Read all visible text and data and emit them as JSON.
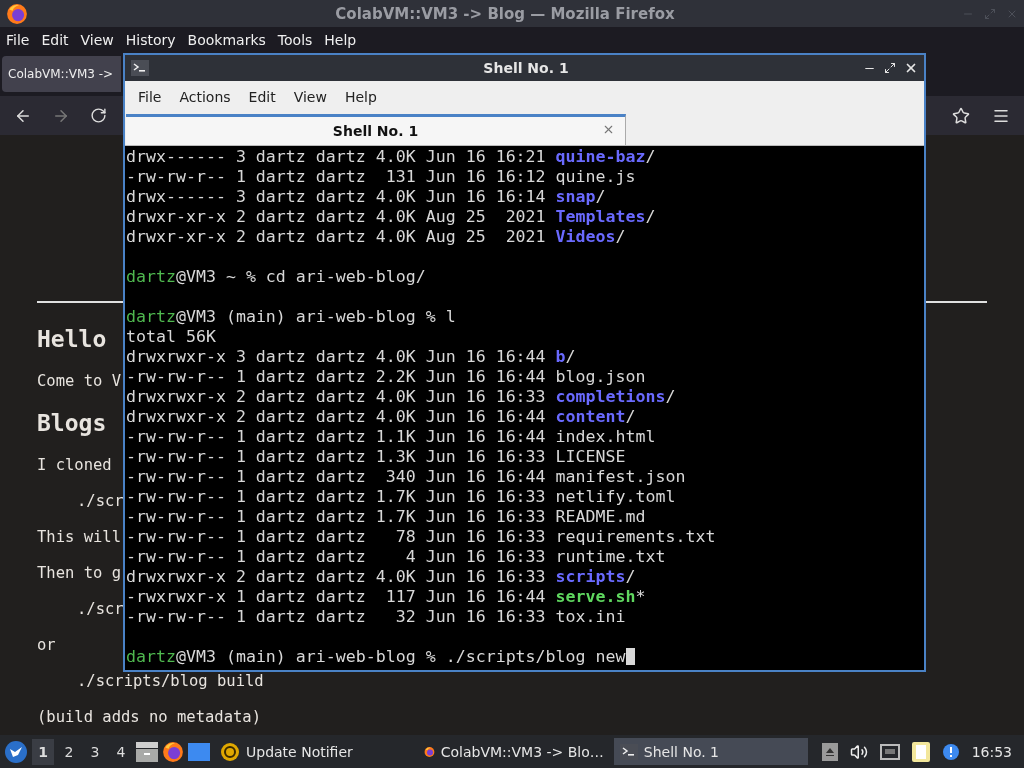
{
  "browser": {
    "title": "ColabVM::VM3 -> Blog — Mozilla Firefox",
    "menu": [
      "File",
      "Edit",
      "View",
      "History",
      "Bookmarks",
      "Tools",
      "Help"
    ],
    "tab": {
      "label": "ColabVM::VM3 ->"
    },
    "page": [
      {
        "kind": "heading",
        "text": "Hello"
      },
      {
        "kind": "para",
        "text": "Come to V"
      },
      {
        "kind": "heading",
        "text": "Blogs"
      },
      {
        "kind": "para",
        "text": "I cloned"
      },
      {
        "kind": "code",
        "text": "./scr"
      },
      {
        "kind": "para",
        "text": "This will"
      },
      {
        "kind": "para",
        "text": "Then to g"
      },
      {
        "kind": "code",
        "text": "./scr"
      },
      {
        "kind": "para",
        "text": "or"
      },
      {
        "kind": "code",
        "text": "./scripts/blog build"
      },
      {
        "kind": "para",
        "text": "(build adds no metadata)"
      }
    ]
  },
  "terminal": {
    "title": "Shell No. 1",
    "menu": [
      "File",
      "Actions",
      "Edit",
      "View",
      "Help"
    ],
    "tabs": [
      {
        "label": "Shell No. 1",
        "selected": true
      }
    ],
    "lines": [
      {
        "kind": "dir",
        "prefix": "drwx------ 3 dartz dartz 4.0K Jun 16 16:21 ",
        "name": "quine-baz",
        "suffix": "/"
      },
      {
        "kind": "file",
        "prefix": "-rw-rw-r-- 1 dartz dartz  131 Jun 16 16:12 ",
        "name": "quine.js"
      },
      {
        "kind": "dir",
        "prefix": "drwx------ 3 dartz dartz 4.0K Jun 16 16:14 ",
        "name": "snap",
        "suffix": "/"
      },
      {
        "kind": "dir",
        "prefix": "drwxr-xr-x 2 dartz dartz 4.0K Aug 25  2021 ",
        "name": "Templates",
        "suffix": "/"
      },
      {
        "kind": "dir",
        "prefix": "drwxr-xr-x 2 dartz dartz 4.0K Aug 25  2021 ",
        "name": "Videos",
        "suffix": "/"
      },
      {
        "kind": "blank"
      },
      {
        "kind": "prompt",
        "user": "dartz",
        "rest": "@VM3 ~ % cd ari-web-blog/"
      },
      {
        "kind": "blank"
      },
      {
        "kind": "prompt",
        "user": "dartz",
        "rest": "@VM3 (main) ari-web-blog % l"
      },
      {
        "kind": "text",
        "text": "total 56K"
      },
      {
        "kind": "dir",
        "prefix": "drwxrwxr-x 3 dartz dartz 4.0K Jun 16 16:44 ",
        "name": "b",
        "suffix": "/"
      },
      {
        "kind": "file",
        "prefix": "-rw-rw-r-- 1 dartz dartz 2.2K Jun 16 16:44 ",
        "name": "blog.json"
      },
      {
        "kind": "dir",
        "prefix": "drwxrwxr-x 2 dartz dartz 4.0K Jun 16 16:33 ",
        "name": "completions",
        "suffix": "/"
      },
      {
        "kind": "dir",
        "prefix": "drwxrwxr-x 2 dartz dartz 4.0K Jun 16 16:44 ",
        "name": "content",
        "suffix": "/"
      },
      {
        "kind": "file",
        "prefix": "-rw-rw-r-- 1 dartz dartz 1.1K Jun 16 16:44 ",
        "name": "index.html"
      },
      {
        "kind": "file",
        "prefix": "-rw-rw-r-- 1 dartz dartz 1.3K Jun 16 16:33 ",
        "name": "LICENSE"
      },
      {
        "kind": "file",
        "prefix": "-rw-rw-r-- 1 dartz dartz  340 Jun 16 16:44 ",
        "name": "manifest.json"
      },
      {
        "kind": "file",
        "prefix": "-rw-rw-r-- 1 dartz dartz 1.7K Jun 16 16:33 ",
        "name": "netlify.toml"
      },
      {
        "kind": "file",
        "prefix": "-rw-rw-r-- 1 dartz dartz 1.7K Jun 16 16:33 ",
        "name": "README.md"
      },
      {
        "kind": "file",
        "prefix": "-rw-rw-r-- 1 dartz dartz   78 Jun 16 16:33 ",
        "name": "requirements.txt"
      },
      {
        "kind": "file",
        "prefix": "-rw-rw-r-- 1 dartz dartz    4 Jun 16 16:33 ",
        "name": "runtime.txt"
      },
      {
        "kind": "dir",
        "prefix": "drwxrwxr-x 2 dartz dartz 4.0K Jun 16 16:33 ",
        "name": "scripts",
        "suffix": "/"
      },
      {
        "kind": "exec",
        "prefix": "-rwxrwxr-x 1 dartz dartz  117 Jun 16 16:44 ",
        "name": "serve.sh",
        "suffix": "*"
      },
      {
        "kind": "file",
        "prefix": "-rw-rw-r-- 1 dartz dartz   32 Jun 16 16:33 ",
        "name": "tox.ini"
      },
      {
        "kind": "blank"
      },
      {
        "kind": "prompt",
        "user": "dartz",
        "rest": "@VM3 (main) ari-web-blog % ./scripts/blog new",
        "cursor": true
      }
    ]
  },
  "taskbar": {
    "workspaces": [
      {
        "label": "1",
        "selected": true
      },
      {
        "label": "2",
        "selected": false
      },
      {
        "label": "3",
        "selected": false
      },
      {
        "label": "4",
        "selected": false
      }
    ],
    "tasks": [
      {
        "label": "Update Notifier",
        "kind": "update",
        "selected": false
      },
      {
        "label": "ColabVM::VM3 -> Blo…",
        "kind": "firefox",
        "selected": false
      },
      {
        "label": "Shell No. 1",
        "kind": "terminal",
        "selected": true
      }
    ],
    "clock": "16:53"
  }
}
